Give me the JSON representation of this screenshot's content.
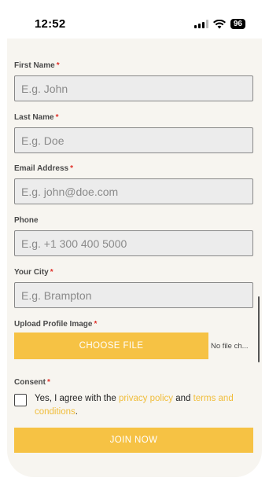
{
  "status_bar": {
    "time": "12:52",
    "battery": "96"
  },
  "form": {
    "required_mark": "*",
    "first_name": {
      "label": "First Name",
      "placeholder": "E.g. John"
    },
    "last_name": {
      "label": "Last Name",
      "placeholder": "E.g. Doe"
    },
    "email": {
      "label": "Email Address",
      "placeholder": "E.g. john@doe.com"
    },
    "phone": {
      "label": "Phone",
      "placeholder": "E.g. +1 300 400 5000"
    },
    "city": {
      "label": "Your City",
      "placeholder": "E.g. Brampton"
    },
    "upload": {
      "label": "Upload Profile Image",
      "button_label": "CHOOSE FILE",
      "file_status": "No file ch..."
    },
    "consent": {
      "label": "Consent",
      "text_before": "Yes, I agree with the ",
      "privacy_link": "privacy policy",
      "text_middle": " and ",
      "terms_link": "terms and conditions",
      "text_after": "."
    },
    "submit_label": "JOIN NOW"
  },
  "colors": {
    "accent": "#f6c244",
    "link": "#f0bd3a",
    "required": "#e0322b",
    "sheet_bg": "#f7f5f0"
  }
}
